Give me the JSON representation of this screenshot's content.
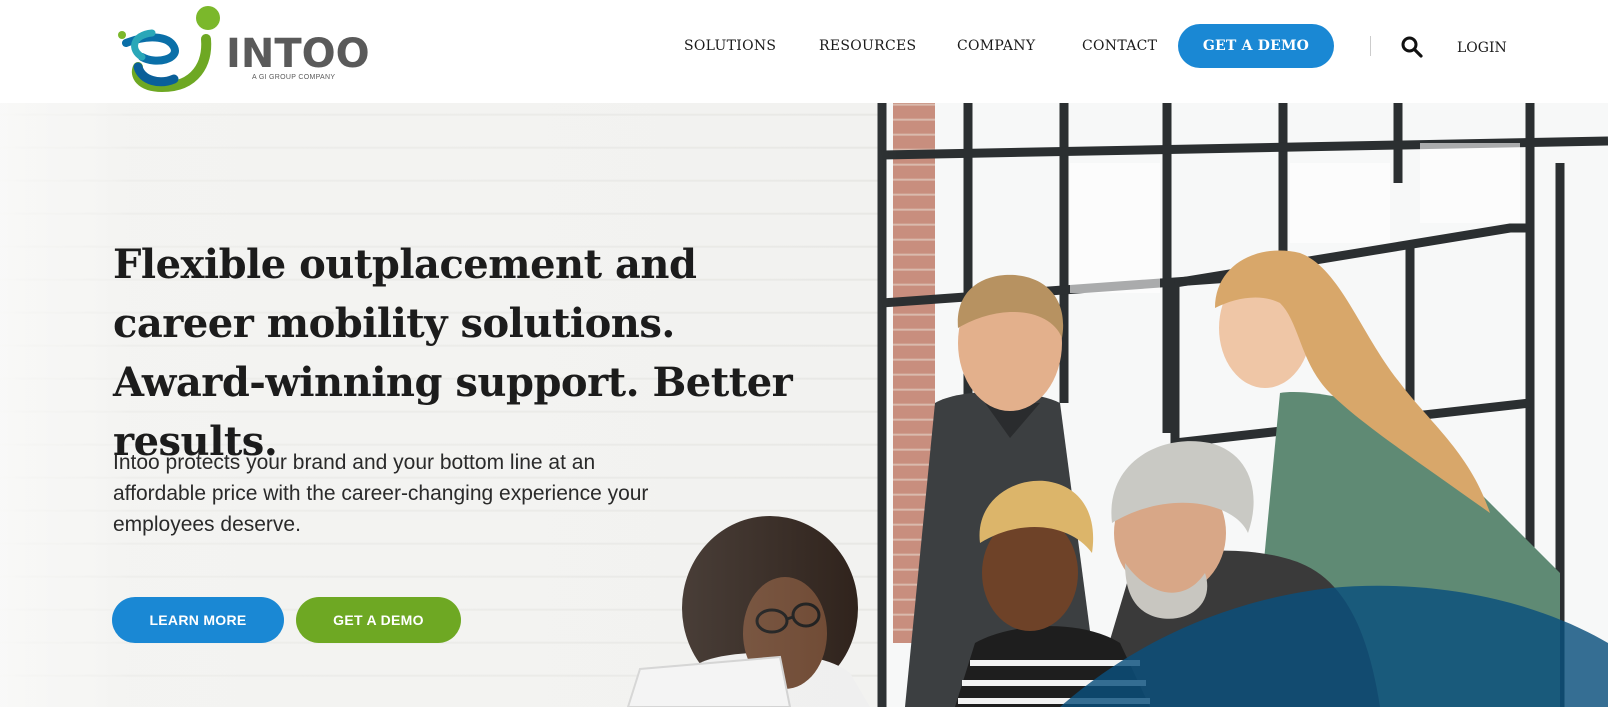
{
  "brand": {
    "name": "INTOO",
    "tagline": "A GI GROUP COMPANY",
    "colors": {
      "green": "#6ea823",
      "blue": "#1a88d4",
      "dark_blue": "#0a4f7d",
      "gray": "#5a5a5a"
    }
  },
  "nav": {
    "items": [
      {
        "label": "SOLUTIONS"
      },
      {
        "label": "RESOURCES"
      },
      {
        "label": "COMPANY"
      },
      {
        "label": "CONTACT"
      }
    ],
    "demo_label": "GET A DEMO",
    "search_icon": "search-icon",
    "login_label": "LOGIN"
  },
  "hero": {
    "headline": "Flexible outplacement and career mobility solutions. Award-winning support. Better results.",
    "subtext": "Intoo protects your brand and your bottom line at an affordable price with the career-changing experience your employees deserve.",
    "learn_more_label": "LEARN MORE",
    "demo_label": "GET A DEMO"
  }
}
